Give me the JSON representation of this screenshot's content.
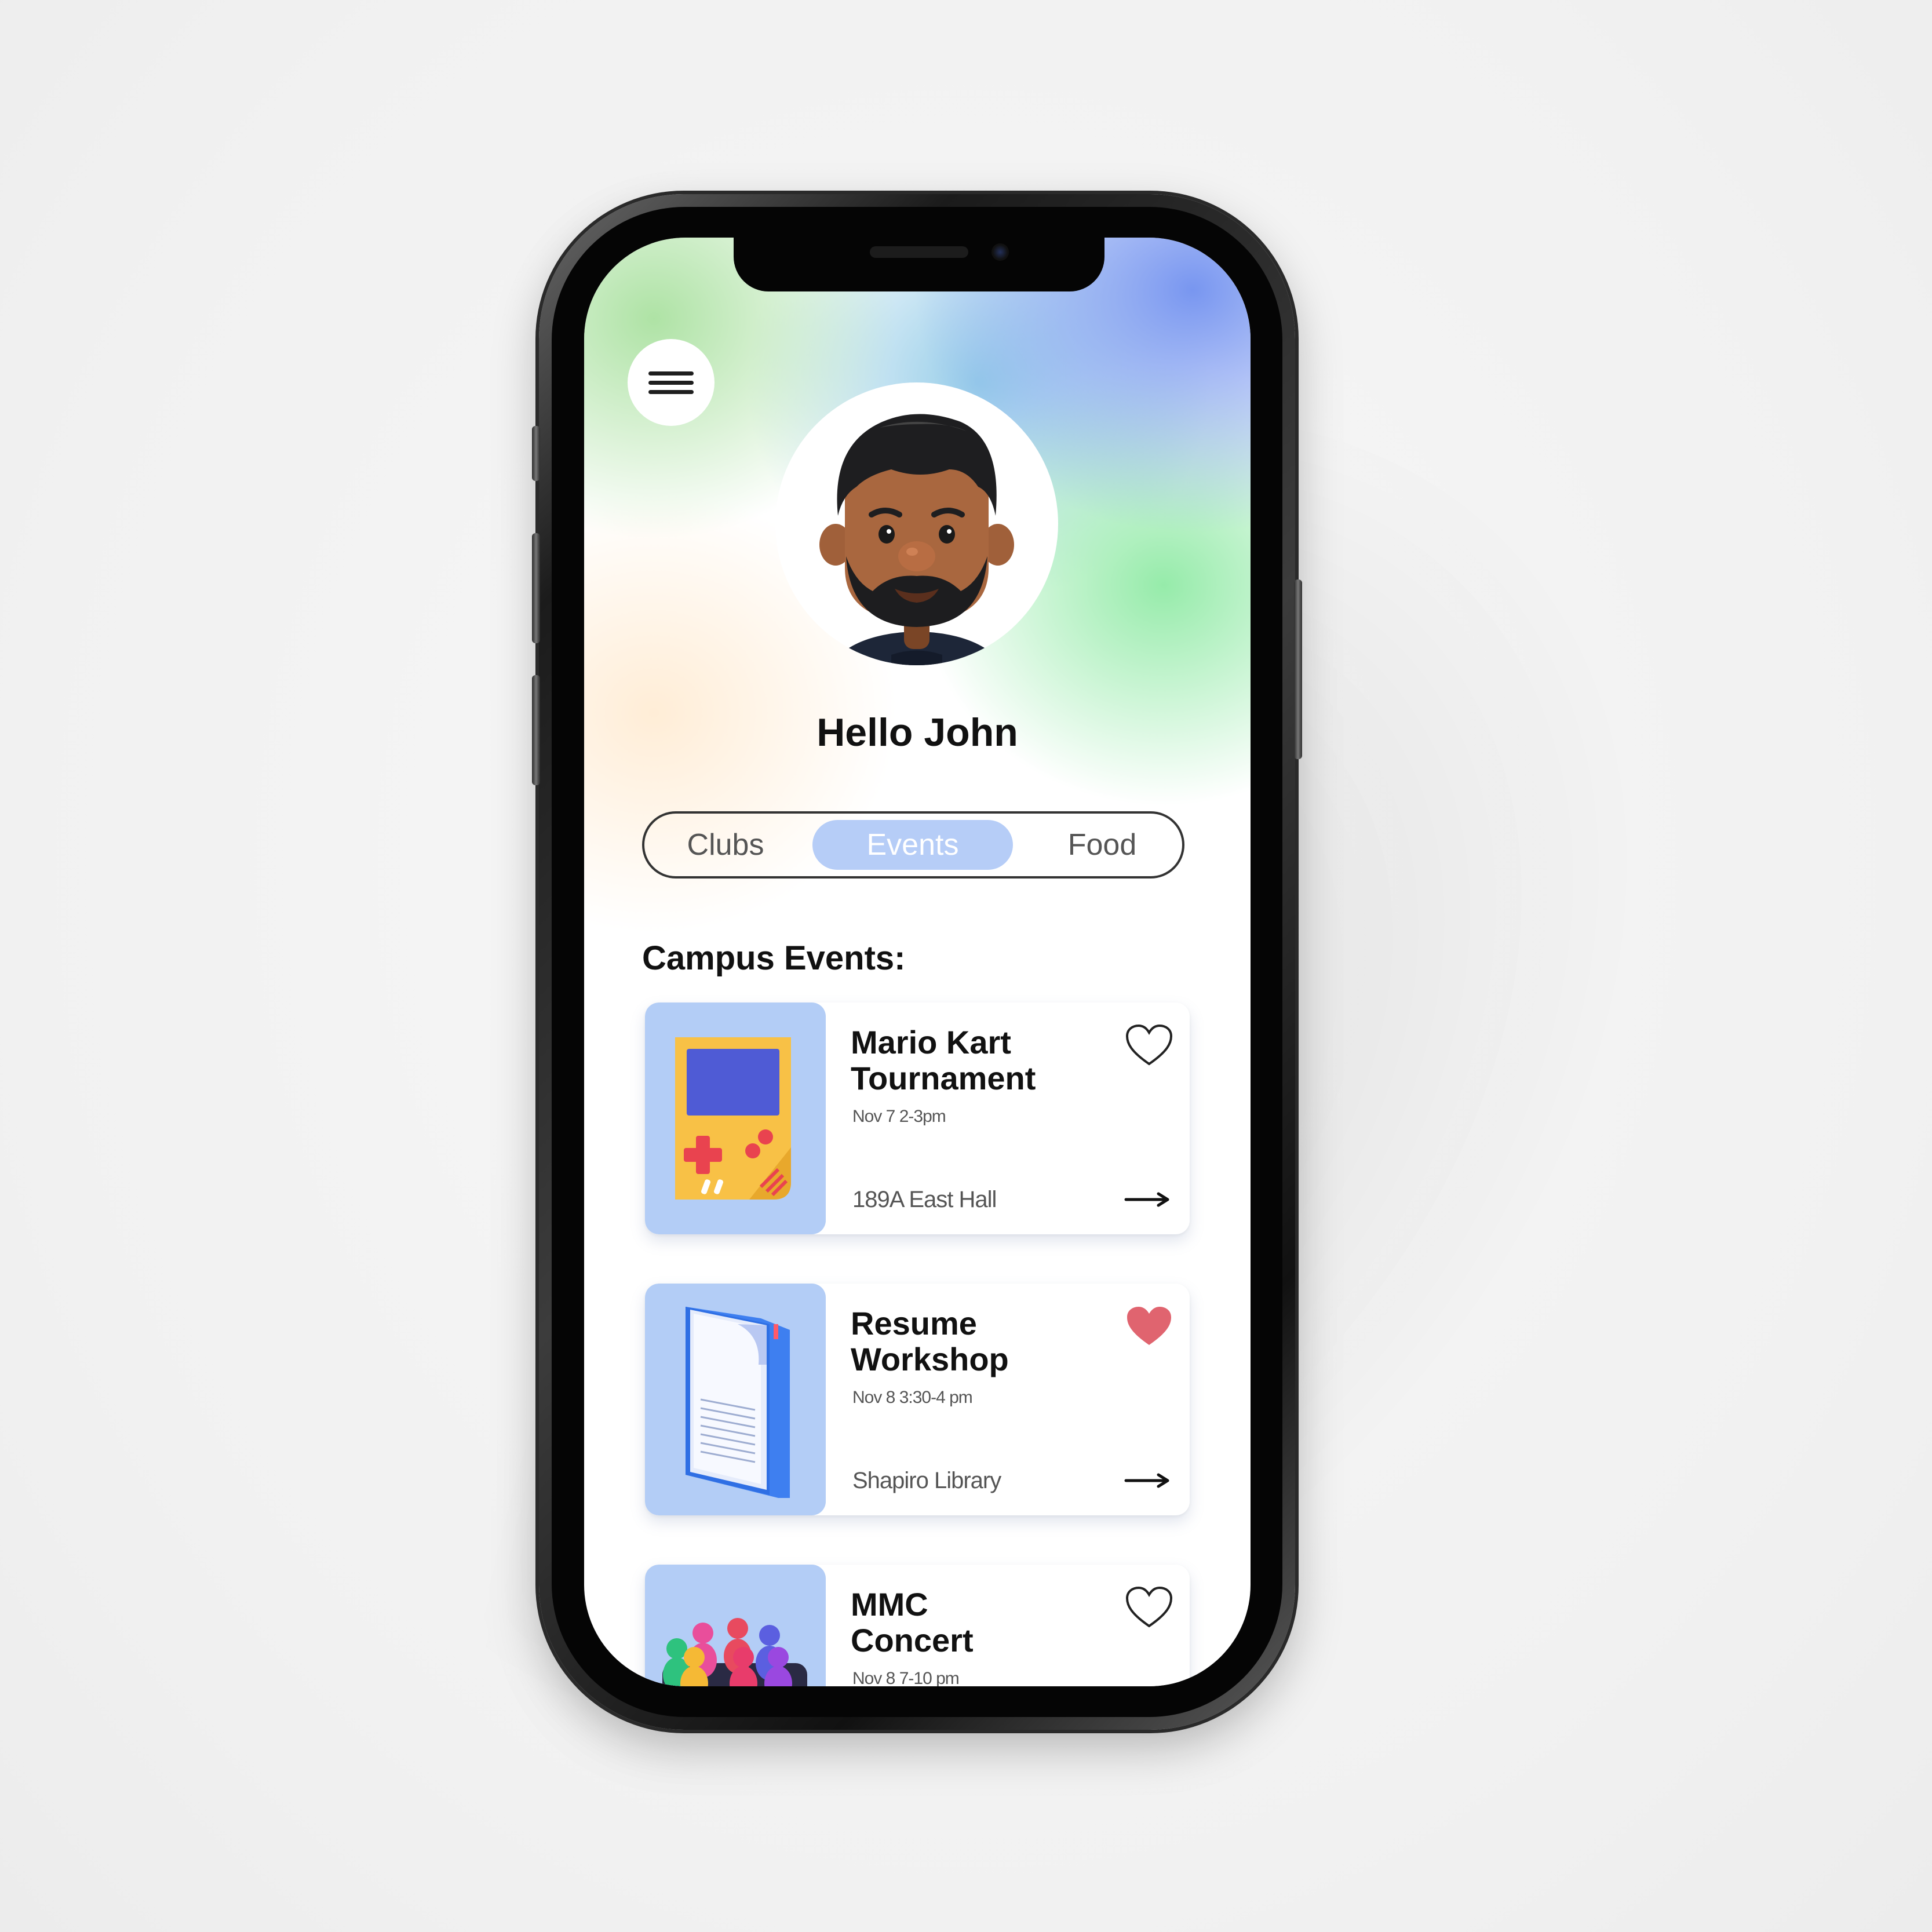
{
  "greeting": "Hello John",
  "tabs": [
    {
      "label": "Clubs",
      "active": false
    },
    {
      "label": "Events",
      "active": true
    },
    {
      "label": "Food",
      "active": false
    }
  ],
  "section_title": "Campus Events:",
  "events": [
    {
      "title_line1": "Mario Kart",
      "title_line2": "Tournament",
      "time": "Nov 7  2-3pm",
      "location": "189A East Hall",
      "favorited": false,
      "thumb_icon": "game-console-icon"
    },
    {
      "title_line1": "Resume",
      "title_line2": "Workshop",
      "time": "Nov 8  3:30-4 pm",
      "location": "Shapiro Library",
      "favorited": true,
      "thumb_icon": "document-icon"
    },
    {
      "title_line1": "MMC",
      "title_line2": "Concert",
      "time": "Nov 8  7-10 pm",
      "location": "",
      "favorited": false,
      "thumb_icon": "crowd-icon"
    }
  ],
  "colors": {
    "tab_active": "#b6cdf7",
    "thumb_bg": "#b3cdf6",
    "heart_filled": "#e0646f"
  }
}
